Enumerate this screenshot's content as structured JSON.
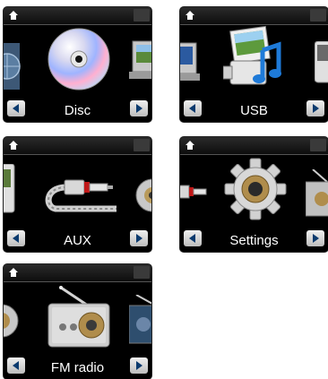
{
  "screens": [
    {
      "label": "Disc",
      "icons": [
        "globe-cd-icon",
        "disc-icon",
        "laptop-photo-icon"
      ]
    },
    {
      "label": "USB",
      "icons": [
        "laptop-partial-icon",
        "usb-media-icon",
        "mp3-player-icon"
      ]
    },
    {
      "label": "AUX",
      "icons": [
        "mp3-player-icon",
        "aux-cable-icon",
        "settings-gear-icon"
      ]
    },
    {
      "label": "Settings",
      "icons": [
        "aux-cable-icon",
        "settings-gear-icon",
        "radio-icon"
      ]
    },
    {
      "label": "FM radio",
      "icons": [
        "settings-gear-icon",
        "radio-icon",
        "radio-partial-icon"
      ]
    }
  ],
  "colors": {
    "screen_bg": "#000000",
    "button_bg": "#d8d8d8",
    "button_arrow": "#0b3a6e",
    "label": "#ffffff"
  }
}
